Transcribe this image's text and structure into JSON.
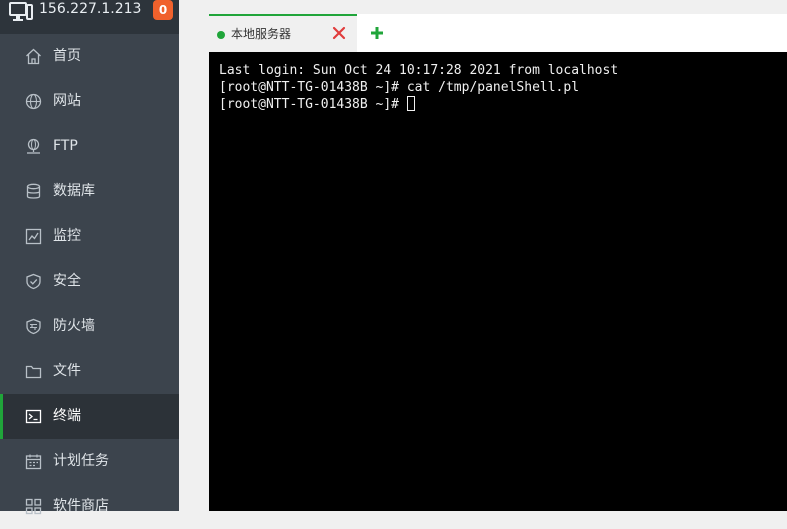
{
  "header": {
    "server_ip": "156.227.1.213",
    "badge_count": "0"
  },
  "sidebar": {
    "items": [
      {
        "label": "首页",
        "icon": "home-icon"
      },
      {
        "label": "网站",
        "icon": "globe-icon"
      },
      {
        "label": "FTP",
        "icon": "ftp-icon"
      },
      {
        "label": "数据库",
        "icon": "database-icon"
      },
      {
        "label": "监控",
        "icon": "monitor-chart-icon"
      },
      {
        "label": "安全",
        "icon": "shield-icon"
      },
      {
        "label": "防火墙",
        "icon": "firewall-icon"
      },
      {
        "label": "文件",
        "icon": "folder-icon"
      },
      {
        "label": "终端",
        "icon": "terminal-icon",
        "active": true
      },
      {
        "label": "计划任务",
        "icon": "calendar-icon"
      },
      {
        "label": "软件商店",
        "icon": "grid-icon"
      }
    ]
  },
  "tabs": [
    {
      "label": "本地服务器",
      "status_color": "#20a53a"
    }
  ],
  "terminal": {
    "lines": [
      "Last login: Sun Oct 24 10:17:28 2021 from localhost",
      "[root@NTT-TG-01438B ~]# cat /tmp/panelShell.pl",
      "[root@NTT-TG-01438B ~]# "
    ]
  },
  "colors": {
    "accent": "#20a53a",
    "badge": "#f0612c",
    "sidebar_bg": "#3c444d",
    "sidebar_header_bg": "#2d343b",
    "close": "#e03c3c"
  }
}
